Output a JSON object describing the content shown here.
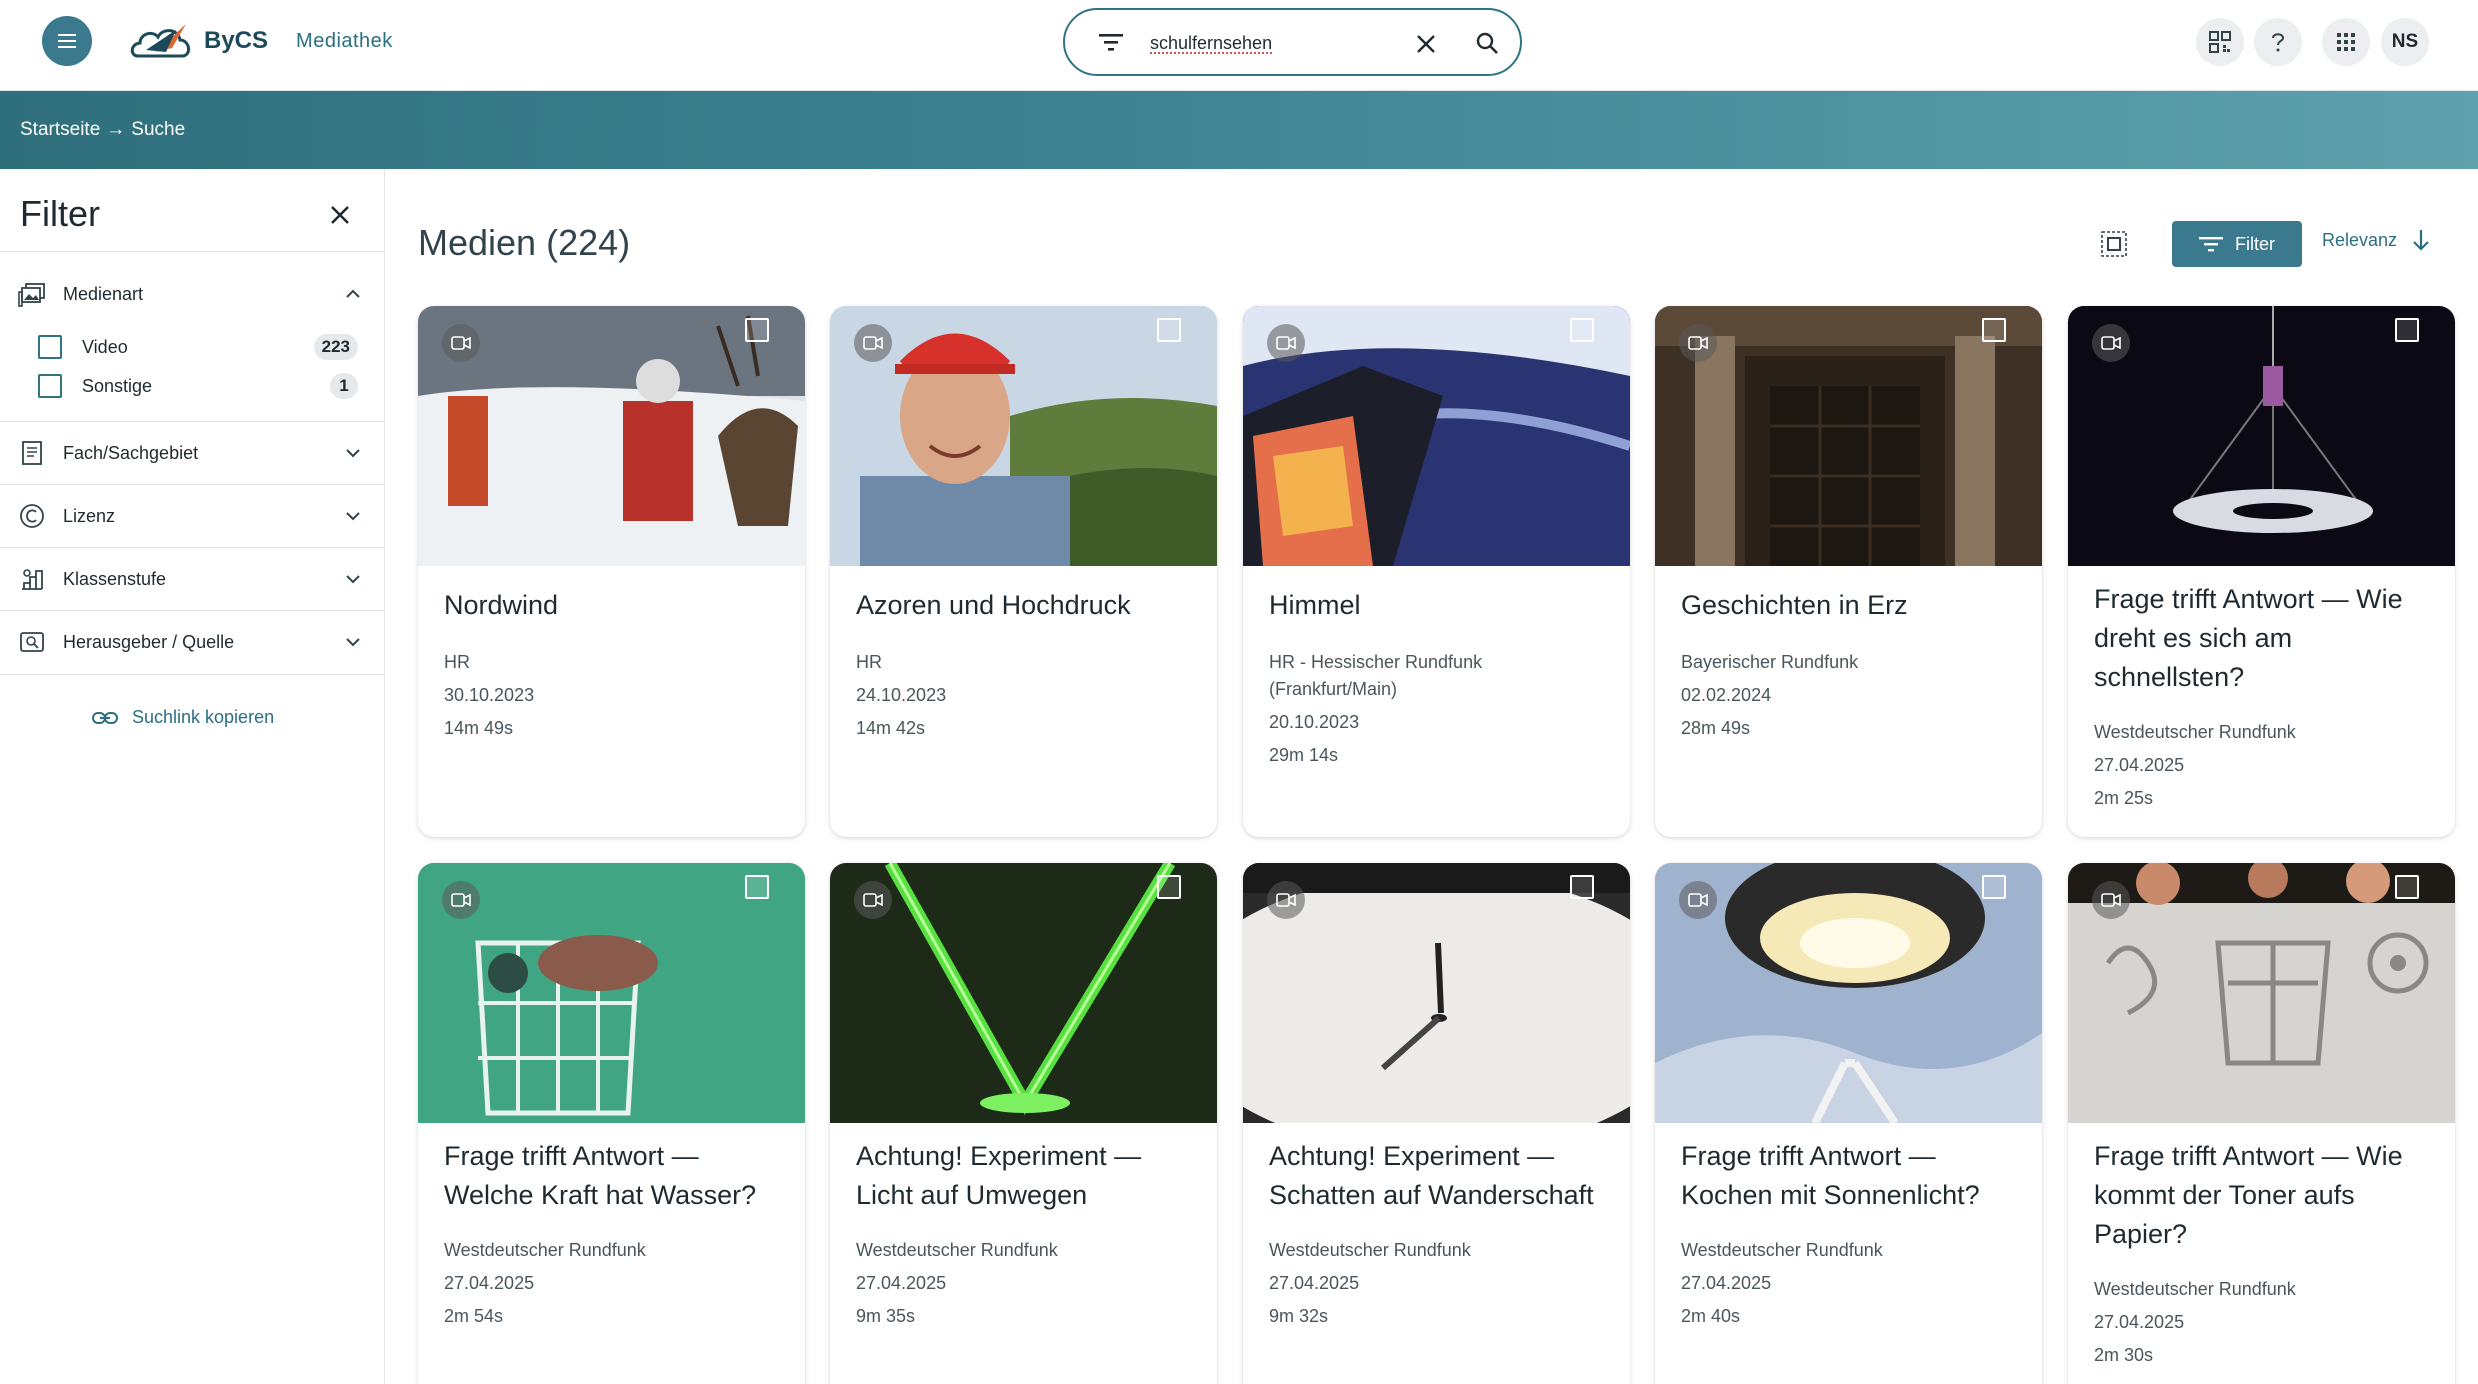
{
  "header": {
    "logo_text": "ByCS",
    "app_name": "Mediathek",
    "search": {
      "value": "schulfernsehen",
      "placeholder": ""
    },
    "avatar_initials": "NS",
    "icons": [
      "menu-icon",
      "filter-icon",
      "close-icon",
      "search-icon",
      "qr-code-icon",
      "help-icon",
      "apps-grid-icon"
    ]
  },
  "breadcrumb": {
    "items": [
      "Startseite",
      "Suche"
    ],
    "separator": "→"
  },
  "sidebar": {
    "title": "Filter",
    "sections": [
      {
        "label": "Medienart",
        "icon": "media-type-icon",
        "expanded": true,
        "options": [
          {
            "label": "Video",
            "count": "223",
            "checked": false
          },
          {
            "label": "Sonstige",
            "count": "1",
            "checked": false
          }
        ]
      },
      {
        "label": "Fach/Sachgebiet",
        "icon": "subject-icon",
        "expanded": false
      },
      {
        "label": "Lizenz",
        "icon": "copyright-icon",
        "expanded": false
      },
      {
        "label": "Klassenstufe",
        "icon": "grade-icon",
        "expanded": false
      },
      {
        "label": "Herausgeber / Quelle",
        "icon": "publisher-icon",
        "expanded": false
      }
    ],
    "copy_link_label": "Suchlink kopieren"
  },
  "main": {
    "title": "Medien (224)",
    "filter_button": "Filter",
    "sort_label": "Relevanz",
    "cards": [
      {
        "title": "Nordwind",
        "publisher": "HR",
        "date": "30.10.2023",
        "duration": "14m 49s"
      },
      {
        "title": "Azoren und Hochdruck",
        "publisher": "HR",
        "date": "24.10.2023",
        "duration": "14m 42s"
      },
      {
        "title": "Himmel",
        "publisher": "HR - Hessischer Rundfunk (Frankfurt/Main)",
        "date": "20.10.2023",
        "duration": "29m 14s"
      },
      {
        "title": "Geschichten in Erz",
        "publisher": "Bayerischer Rundfunk",
        "date": "02.02.2024",
        "duration": "28m 49s"
      },
      {
        "title": "Frage trifft Antwort — Wie dreht es sich am schnellsten?",
        "publisher": "Westdeutscher Rundfunk",
        "date": "27.04.2025",
        "duration": "2m 25s"
      },
      {
        "title": "Frage trifft Antwort — Welche Kraft hat Wasser?",
        "publisher": "Westdeutscher Rundfunk",
        "date": "27.04.2025",
        "duration": "2m 54s"
      },
      {
        "title": "Achtung! Experiment — Licht auf Umwegen",
        "publisher": "Westdeutscher Rundfunk",
        "date": "27.04.2025",
        "duration": "9m 35s"
      },
      {
        "title": "Achtung! Experiment — Schatten auf Wanderschaft",
        "publisher": "Westdeutscher Rundfunk",
        "date": "27.04.2025",
        "duration": "9m 32s"
      },
      {
        "title": "Frage trifft Antwort — Kochen mit Sonnenlicht?",
        "publisher": "Westdeutscher Rundfunk",
        "date": "27.04.2025",
        "duration": "2m 40s"
      },
      {
        "title": "Frage trifft Antwort — Wie kommt der Toner aufs Papier?",
        "publisher": "Westdeutscher Rundfunk",
        "date": "27.04.2025",
        "duration": "2m 30s"
      }
    ]
  },
  "colors": {
    "accent": "#3b7a8e",
    "link": "#2b6f82",
    "band_start": "#2f6f7c",
    "band_end": "#5fa1ad"
  }
}
